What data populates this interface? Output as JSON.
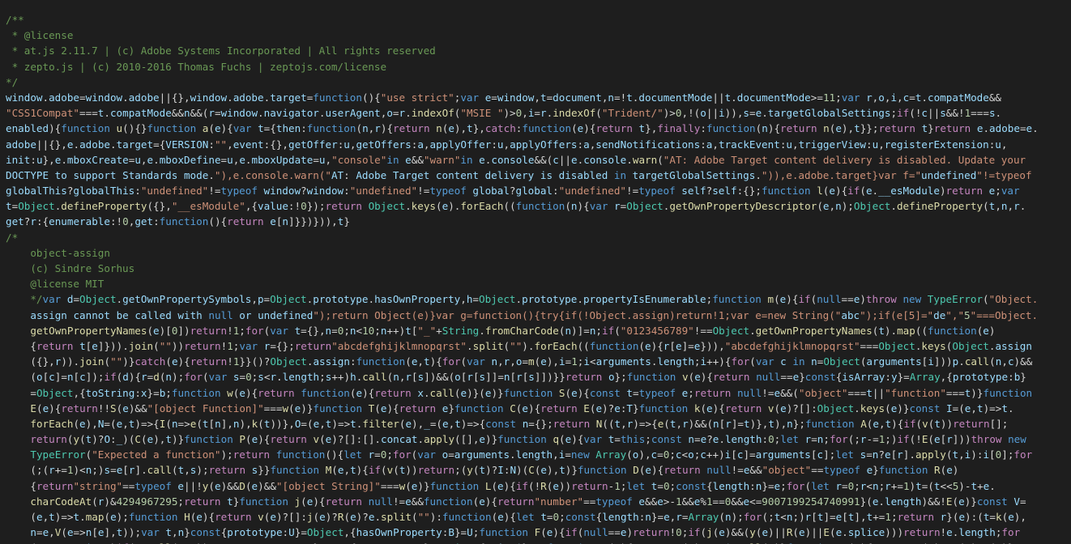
{
  "editor": {
    "language": "javascript",
    "theme": "dark",
    "colors": {
      "background": "#1e1e1e",
      "text": "#d4d4d4",
      "comment": "#6a9955",
      "string": "#ce9178",
      "keyword": "#569cd6",
      "control": "#c586c0",
      "function": "#dcdcaa",
      "variable": "#9cdcfe",
      "number": "#b5cea8",
      "type": "#4ec9b0"
    },
    "lines": [
      "/**",
      " * @license",
      " * at.js 2.11.7 | (c) Adobe Systems Incorporated | All rights reserved",
      " * zepto.js | (c) 2010-2016 Thomas Fuchs | zeptojs.com/license",
      "*/",
      "window.adobe=window.adobe||{},window.adobe.target=function(){\"use strict\";var e=window,t=document,n=!t.documentMode||t.documentMode>=11;var r,o,i,c=t.compatMode&&",
      "\"CSS1Compat\"===t.compatMode&&n&&(r=window.navigator.userAgent,o=r.indexOf(\"MSIE \")>0,i=r.indexOf(\"Trident/\")>0,!(o||i)),s=e.targetGlobalSettings;if(!c||s&&!1===s.",
      "enabled){function u(){}function a(e){var t={then:function(n,r){return n(e),t},catch:function(e){return t},finally:function(n){return n(e),t}};return t}return e.adobe=e.",
      "adobe||{},e.adobe.target={VERSION:\"\",event:{},getOffer:u,getOffers:a,applyOffer:u,applyOffers:a,sendNotifications:a,trackEvent:u,triggerView:u,registerExtension:u,",
      "init:u},e.mboxCreate=u,e.mboxDefine=u,e.mboxUpdate=u,\"console\"in e&&\"warn\"in e.console&&(c||e.console.warn(\"AT: Adobe Target content delivery is disabled. Update your",
      "DOCTYPE to support Standards mode.\"),e.console.warn(\"AT: Adobe Target content delivery is disabled in targetGlobalSettings.\")),e.adobe.target}var f=\"undefined\"!=typeof",
      "globalThis?globalThis:\"undefined\"!=typeof window?window:\"undefined\"!=typeof global?global:\"undefined\"!=typeof self?self:{};function l(e){if(e.__esModule)return e;var",
      "t=Object.defineProperty({},\"__esModule\",{value:!0});return Object.keys(e).forEach((function(n){var r=Object.getOwnPropertyDescriptor(e,n);Object.defineProperty(t,n,r.",
      "get?r:{enumerable:!0,get:function(){return e[n]}})})),t}",
      "/*",
      "    object-assign",
      "    (c) Sindre Sorhus",
      "    @license MIT",
      "    */var d=Object.getOwnPropertySymbols,p=Object.prototype.hasOwnProperty,h=Object.prototype.propertyIsEnumerable;function m(e){if(null==e)throw new TypeError(\"Object.",
      "    assign cannot be called with null or undefined\");return Object(e)}var g=function(){try{if(!Object.assign)return!1;var e=new String(\"abc\");if(e[5]=\"de\",\"5\"===Object.",
      "    getOwnPropertyNames(e)[0])return!1;for(var t={},n=0;n<10;n++)t[\"_\"+String.fromCharCode(n)]=n;if(\"0123456789\"!==Object.getOwnPropertyNames(t).map((function(e)",
      "    {return t[e]})).join(\"\"))return!1;var r={};return\"abcdefghijklmnopqrst\".split(\"\").forEach((function(e){r[e]=e})),\"abcdefghijklmnopqrst\"===Object.keys(Object.assign",
      "    ({},r)).join(\"\")}catch(e){return!1}}()?Object.assign:function(e,t){for(var n,r,o=m(e),i=1;i<arguments.length;i++){for(var c in n=Object(arguments[i]))p.call(n,c)&&",
      "    (o[c]=n[c]);if(d){r=d(n);for(var s=0;s<r.length;s++)h.call(n,r[s])&&(o[r[s]]=n[r[s]])}}return o};function v(e){return null==e}const{isArray:y}=Array,{prototype:b}",
      "    =Object,{toString:x}=b;function w(e){return function(e){return x.call(e)}(e)}function S(e){const t=typeof e;return null!=e&&(\"object\"===t||\"function\"===t)}function",
      "    E(e){return!!S(e)&&\"[object Function]\"===w(e)}function T(e){return e}function C(e){return E(e)?e:T}function k(e){return v(e)?[]:Object.keys(e)}const I=(e,t)=>t.",
      "    forEach(e),N=(e,t)=>{I(n=>e(t[n],n),k(t))},O=(e,t)=>t.filter(e),_=(e,t)=>{const n={};return N((t,r)=>{e(t,r)&&(n[r]=t)},t),n};function A(e,t){if(v(t))return[];",
      "    return(y(t)?O:_)(C(e),t)}function P(e){return v(e)?[]:[].concat.apply([],e)}function q(e){var t=this;const n=e?e.length:0;let r=n;for(;r-=1;)if(!E(e[r]))throw new",
      "    TypeError(\"Expected a function\");return function(){let r=0;for(var o=arguments.length,i=new Array(o),c=0;c<o;c++)i[c]=arguments[c];let s=n?e[r].apply(t,i):i[0];for",
      "    (;(r+=1)<n;)s=e[r].call(t,s);return s}}function M(e,t){if(v(t))return;(y(t)?I:N)(C(e),t)}function D(e){return null!=e&&\"object\"==typeof e}function R(e)",
      "    {return\"string\"==typeof e||!y(e)&&D(e)&&\"[object String]\"===w(e)}function L(e){if(!R(e))return-1;let t=0;const{length:n}=e;for(let r=0;r<n;r+=1)t=(t<<5)-t+e.",
      "    charCodeAt(r)&4294967295;return t}function j(e){return null!=e&&function(e){return\"number\"==typeof e&&e>-1&&e%1==0&&e<=9007199254740991}(e.length)&&!E(e)}const V=",
      "    (e,t)=>t.map(e);function H(e){return v(e)?[]:j(e)?R(e)?e.split(\"\"):function(e){let t=0;const{length:n}=e,r=Array(n);for(;t<n;)r[t]=e[t],t+=1;return r}(e):(t=k(e),",
      "    n=e,V(e=>n[e],t));var t,n}const{prototype:U}=Object,{hasOwnProperty:B}=U;function F(e){if(null==e)return!0;if(j(e)&&(y(e)||R(e)||E(e.splice)))return!e.length;for",
      "    (const t in e)if(B.call(e,t))return!1;return!0}const{prototype:z}=String,{trim:$}=z;function J(e){return v(e)?\"\":$.call(e)}function Z(e){return R(e)?!J(e):F(e)}"
    ]
  }
}
